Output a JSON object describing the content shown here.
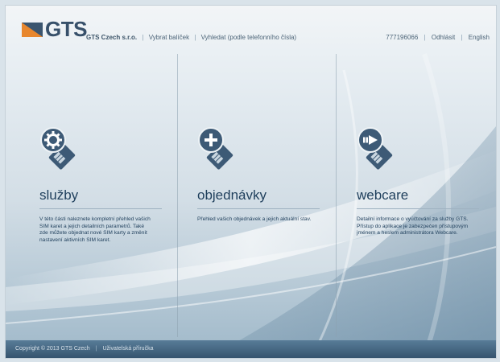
{
  "brand": {
    "logo_text": "GTS",
    "colors": {
      "dark": "#37506a",
      "accent": "#3d5a76"
    }
  },
  "topnav": {
    "company": "GTS Czech s.r.o.",
    "separator": "|",
    "items": [
      "Vybrat balíček",
      "Vyhledat (podle telefonního čísla)"
    ]
  },
  "rightnav": {
    "phone": "777196066",
    "logout": "Odhlásit",
    "language": "English",
    "separator": "|"
  },
  "panels": [
    {
      "title": "služby",
      "icon": "gear-sim-icon",
      "description": "V této části naleznete kompletní přehled vašich SIM karet a jejich detailních parametrů. Také zde můžete objednat nové SIM karty a změnit nastavení aktivních SIM karet."
    },
    {
      "title": "objednávky",
      "icon": "plus-sim-icon",
      "description": "Přehled vašich objednávek a jejich aktuální stav."
    },
    {
      "title": "webcare",
      "icon": "arrow-sim-icon",
      "description": "Detailní informace o vyúčtování za služby GTS. Přístup do aplikace je zabezpečen přístupovým jménem a heslem administrátora Webcare."
    }
  ],
  "footer": {
    "copyright": "Copyright © 2013 GTS Czech",
    "separator": "|",
    "manual": "Uživatelská příručka"
  }
}
